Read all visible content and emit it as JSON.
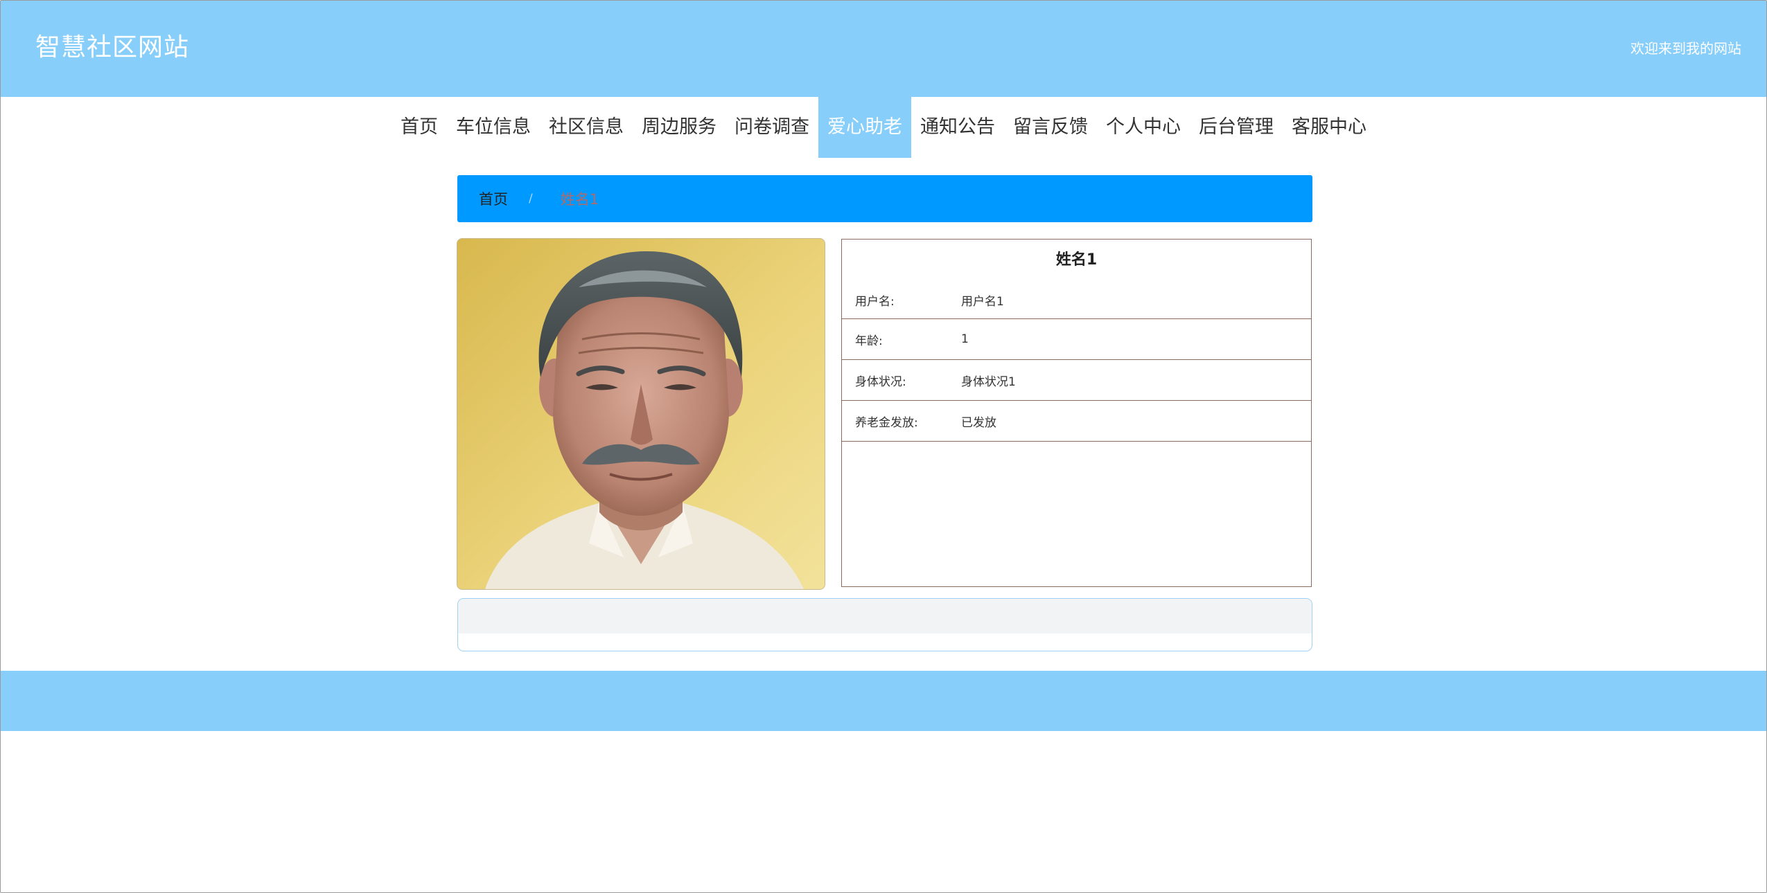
{
  "header": {
    "site_title": "智慧社区网站",
    "welcome_text": "欢迎来到我的网站"
  },
  "nav": {
    "items": [
      {
        "label": "首页"
      },
      {
        "label": "车位信息"
      },
      {
        "label": "社区信息"
      },
      {
        "label": "周边服务"
      },
      {
        "label": "问卷调查"
      },
      {
        "label": "爱心助老"
      },
      {
        "label": "通知公告"
      },
      {
        "label": "留言反馈"
      },
      {
        "label": "个人中心"
      },
      {
        "label": "后台管理"
      },
      {
        "label": "客服中心"
      }
    ],
    "active_label": "爱心助老"
  },
  "breadcrumb": {
    "home": "首页",
    "separator": "/",
    "current": "姓名1"
  },
  "detail": {
    "title": "姓名1",
    "rows": [
      {
        "label": "用户名:",
        "value": "用户名1"
      },
      {
        "label": "年龄:",
        "value": "1"
      },
      {
        "label": "身体状况:",
        "value": "身体状况1"
      },
      {
        "label": "养老金发放:",
        "value": "已发放"
      }
    ]
  },
  "colors": {
    "header_bg": "#87cefa",
    "breadcrumb_bg": "#0099ff",
    "table_border": "#8b6b5d"
  }
}
